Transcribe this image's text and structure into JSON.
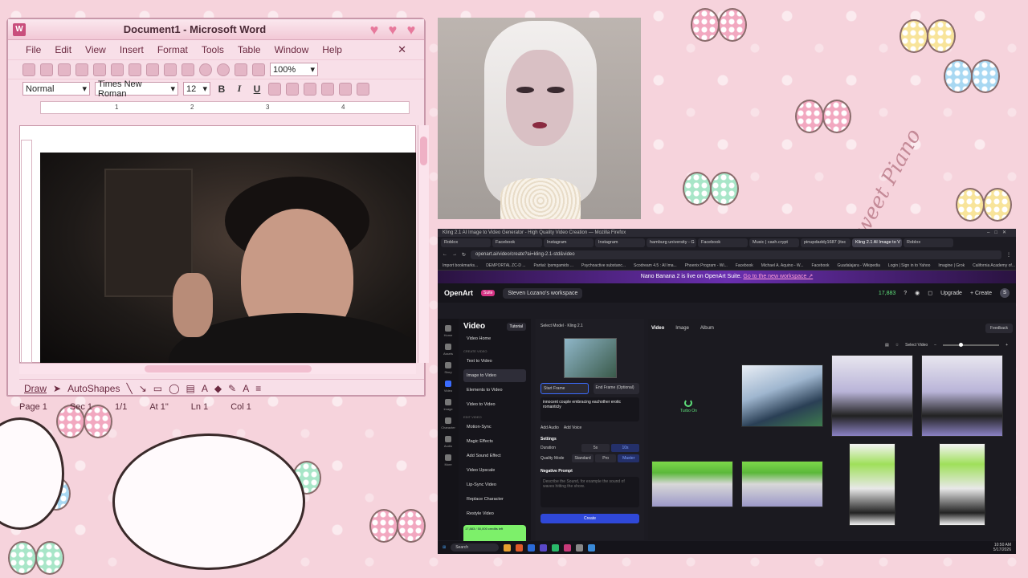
{
  "colors": {
    "wallpaper_pink": "#f6d3dc",
    "word_frame": "#f8dfe8",
    "browser_dark": "#1c1b22",
    "openart_purple": "#6a2fb0",
    "accent_blue": "#2f48d8",
    "credit_green": "#5ee07a"
  },
  "wallpaper": {
    "signature": "Sweet Piano"
  },
  "word": {
    "title": "Document1 - Microsoft Word",
    "app_icon": "W",
    "menu": [
      "File",
      "Edit",
      "View",
      "Insert",
      "Format",
      "Tools",
      "Table",
      "Window",
      "Help"
    ],
    "zoom": "100%",
    "style": "Normal",
    "font": "Times New Roman",
    "font_size": "12",
    "bold": "B",
    "italic": "I",
    "underline": "U",
    "ruler_numbers": [
      "1",
      "2",
      "3",
      "4"
    ],
    "draw_label": "Draw",
    "autoshapes_label": "AutoShapes",
    "status": {
      "page": "Page  1",
      "sec": "Sec  1",
      "pages": "1/1",
      "at": "At  1\"",
      "ln": "Ln  1",
      "col": "Col  1"
    }
  },
  "browser": {
    "window_title": "Kling 2.1 AI Image to Video Generator - High Quality Video Creation — Mozilla Firefox",
    "tabs": [
      "Roblox",
      "Facebook",
      "Instagram",
      "Instagram",
      "hamburg university - G",
      "Facebook",
      "Music | cash.crypt",
      "pinupdaddy1687 (itsc",
      "Kling 2.1 AI Image to V",
      "Roblox"
    ],
    "url": "openart.ai/video/create?ai=kling-2.1-std&video",
    "bookmarks": [
      "Import bookmarks...",
      "DEMPORTAL ZC-D ...",
      "Partial: Ipsmgamids ...",
      "Psychoactive substanc...",
      "Scodream 4.5 : AI Ima...",
      "Phoenix Program - Wi...",
      "Facebook",
      "Michael A. Aquino - W...",
      "Facebook",
      "Guadalajara - Wikipedia",
      "Login | Sign in to Yahoo",
      "Imagine | Grok",
      "California Academy of..."
    ],
    "banner": "Nano Banana 2 is live on OpenArt Suite.",
    "banner_link": "Go to the new workspace ↗"
  },
  "openart": {
    "logo": "OpenArt",
    "badge": "Suite",
    "workspace": "Steven Lozano's workspace",
    "credits": "17,883",
    "upgrade": "Upgrade",
    "create": "+ Create",
    "avatar": "S",
    "rail": [
      "Home",
      "Assets",
      "Story",
      "Video",
      "Image",
      "Character",
      "Audio",
      "More"
    ],
    "side_title": "Video",
    "tutorial": "Tutorial",
    "side_items": [
      "Video Home",
      "Text to Video",
      "Image to Video",
      "Elements to Video",
      "Video to Video",
      "Motion-Sync",
      "Magic Effects",
      "Add Sound Effect",
      "Video Upscale",
      "Lip-Sync Video",
      "Replace Character",
      "Restyle Video"
    ],
    "side_sections": [
      "CREATE VIDEO",
      "EDIT VIDEO"
    ],
    "upgrade_card": "17,883 / 50,000 credits left",
    "panel": {
      "model_label": "Select Model",
      "model": "Kling 2.1",
      "start_frame": "Start Frame",
      "end_frame": "End Frame (Optional)",
      "prompt": "innocent couple embracing eachother erotic romanticly",
      "add_audio": "Add Audio",
      "add_voice": "Add Voice",
      "settings": "Settings",
      "duration_label": "Duration",
      "durations": [
        "5s",
        "10s"
      ],
      "quality_label": "Quality Mode",
      "qualities": [
        "Standard",
        "Pro",
        "Master"
      ],
      "negative": "Negative Prompt",
      "negative_placeholder": "Describe the Sound, for example the sound of waves hitting the shore.",
      "create": "Create"
    },
    "gallery": {
      "tabs": [
        "Video",
        "Image",
        "Album"
      ],
      "feedback": "Feedback",
      "select_video": "Select Video",
      "generating": "Turbo On"
    }
  },
  "taskbar": {
    "search": "Search",
    "time": "10:50 AM",
    "date": "5/17/2026"
  }
}
